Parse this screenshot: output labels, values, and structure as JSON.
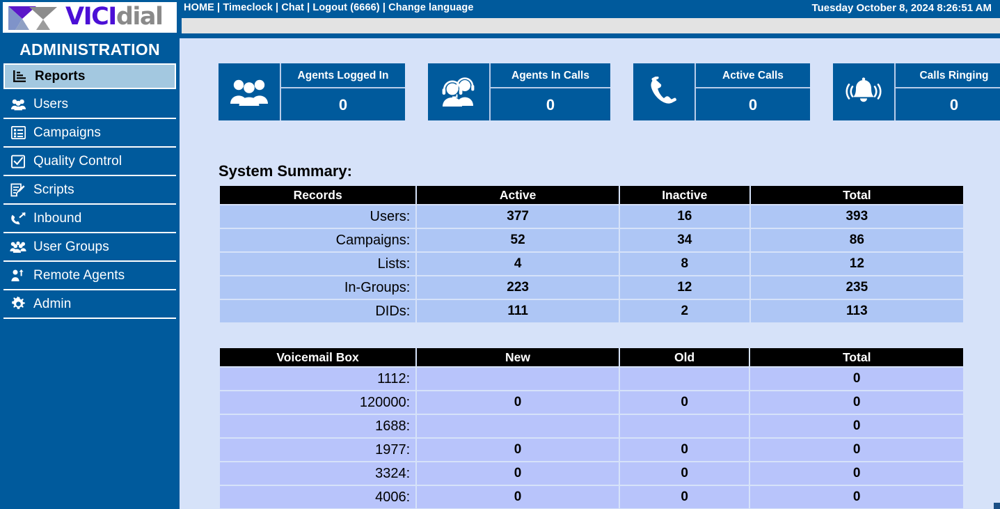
{
  "brand": {
    "logo_text_primary": "VICI",
    "logo_text_secondary": "dial",
    "accent_blue": "#005a9c",
    "content_bg": "#d6e2f9",
    "table_row_bg": "#aec6f5",
    "voicemail_row_bg": "#b8c4fb",
    "active_item_bg": "#a3c8e0"
  },
  "topnav": {
    "links": [
      {
        "label": "HOME",
        "name": "nav-home"
      },
      {
        "label": "Timeclock",
        "name": "nav-timeclock"
      },
      {
        "label": "Chat",
        "name": "nav-chat"
      },
      {
        "label": "Logout (6666)",
        "name": "nav-logout"
      },
      {
        "label": "Change language",
        "name": "nav-change-language"
      }
    ],
    "separator": " | ",
    "datetime": "Tuesday October 8, 2024 8:26:51 AM"
  },
  "sidebar": {
    "title": "ADMINISTRATION",
    "items": [
      {
        "label": "Reports",
        "icon": "bar-chart-icon",
        "active": true
      },
      {
        "label": "Users",
        "icon": "users-icon",
        "active": false
      },
      {
        "label": "Campaigns",
        "icon": "list-icon",
        "active": false
      },
      {
        "label": "Quality Control",
        "icon": "checkbox-icon",
        "active": false
      },
      {
        "label": "Scripts",
        "icon": "edit-document-icon",
        "active": false
      },
      {
        "label": "Inbound",
        "icon": "inbound-call-icon",
        "active": false
      },
      {
        "label": "User Groups",
        "icon": "user-groups-icon",
        "active": false
      },
      {
        "label": "Remote Agents",
        "icon": "remote-agent-icon",
        "active": false
      },
      {
        "label": "Admin",
        "icon": "gear-icon",
        "active": false
      }
    ]
  },
  "stat_cards": [
    {
      "label": "Agents Logged In",
      "value": "0",
      "icon": "people-group-icon"
    },
    {
      "label": "Agents In Calls",
      "value": "0",
      "icon": "headset-agents-icon"
    },
    {
      "label": "Active Calls",
      "value": "0",
      "icon": "phone-handset-icon"
    },
    {
      "label": "Calls Ringing",
      "value": "0",
      "icon": "ringing-bell-icon"
    }
  ],
  "system_summary": {
    "title": "System Summary:",
    "headers": [
      "Records",
      "Active",
      "Inactive",
      "Total"
    ],
    "rows": [
      {
        "label": "Users:",
        "active": "377",
        "inactive": "16",
        "total": "393"
      },
      {
        "label": "Campaigns:",
        "active": "52",
        "inactive": "34",
        "total": "86"
      },
      {
        "label": "Lists:",
        "active": "4",
        "inactive": "8",
        "total": "12"
      },
      {
        "label": "In-Groups:",
        "active": "223",
        "inactive": "12",
        "total": "235"
      },
      {
        "label": "DIDs:",
        "active": "111",
        "inactive": "2",
        "total": "113"
      }
    ]
  },
  "voicemail": {
    "headers": [
      "Voicemail Box",
      "New",
      "Old",
      "Total"
    ],
    "rows": [
      {
        "label": "1112:",
        "new": "",
        "old": "",
        "total": "0"
      },
      {
        "label": "120000:",
        "new": "0",
        "old": "0",
        "total": "0"
      },
      {
        "label": "1688:",
        "new": "",
        "old": "",
        "total": "0"
      },
      {
        "label": "1977:",
        "new": "0",
        "old": "0",
        "total": "0"
      },
      {
        "label": "3324:",
        "new": "0",
        "old": "0",
        "total": "0"
      },
      {
        "label": "4006:",
        "new": "0",
        "old": "0",
        "total": "0"
      }
    ]
  }
}
